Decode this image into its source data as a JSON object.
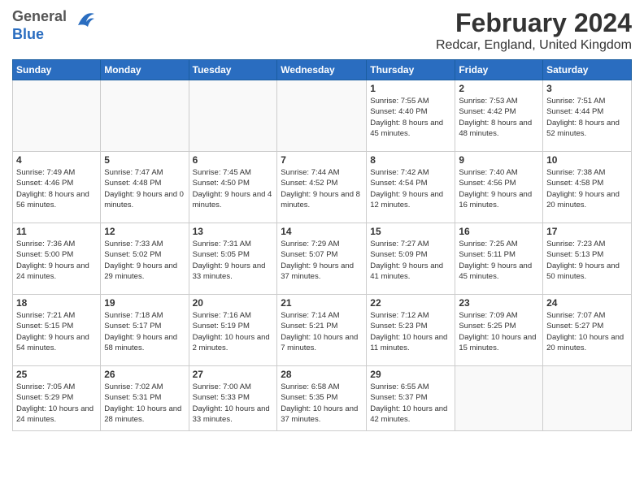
{
  "header": {
    "logo_general": "General",
    "logo_blue": "Blue",
    "title": "February 2024",
    "subtitle": "Redcar, England, United Kingdom"
  },
  "days_of_week": [
    "Sunday",
    "Monday",
    "Tuesday",
    "Wednesday",
    "Thursday",
    "Friday",
    "Saturday"
  ],
  "weeks": [
    [
      {
        "day": "",
        "sunrise": "",
        "sunset": "",
        "daylight": ""
      },
      {
        "day": "",
        "sunrise": "",
        "sunset": "",
        "daylight": ""
      },
      {
        "day": "",
        "sunrise": "",
        "sunset": "",
        "daylight": ""
      },
      {
        "day": "",
        "sunrise": "",
        "sunset": "",
        "daylight": ""
      },
      {
        "day": "1",
        "sunrise": "Sunrise: 7:55 AM",
        "sunset": "Sunset: 4:40 PM",
        "daylight": "Daylight: 8 hours and 45 minutes."
      },
      {
        "day": "2",
        "sunrise": "Sunrise: 7:53 AM",
        "sunset": "Sunset: 4:42 PM",
        "daylight": "Daylight: 8 hours and 48 minutes."
      },
      {
        "day": "3",
        "sunrise": "Sunrise: 7:51 AM",
        "sunset": "Sunset: 4:44 PM",
        "daylight": "Daylight: 8 hours and 52 minutes."
      }
    ],
    [
      {
        "day": "4",
        "sunrise": "Sunrise: 7:49 AM",
        "sunset": "Sunset: 4:46 PM",
        "daylight": "Daylight: 8 hours and 56 minutes."
      },
      {
        "day": "5",
        "sunrise": "Sunrise: 7:47 AM",
        "sunset": "Sunset: 4:48 PM",
        "daylight": "Daylight: 9 hours and 0 minutes."
      },
      {
        "day": "6",
        "sunrise": "Sunrise: 7:45 AM",
        "sunset": "Sunset: 4:50 PM",
        "daylight": "Daylight: 9 hours and 4 minutes."
      },
      {
        "day": "7",
        "sunrise": "Sunrise: 7:44 AM",
        "sunset": "Sunset: 4:52 PM",
        "daylight": "Daylight: 9 hours and 8 minutes."
      },
      {
        "day": "8",
        "sunrise": "Sunrise: 7:42 AM",
        "sunset": "Sunset: 4:54 PM",
        "daylight": "Daylight: 9 hours and 12 minutes."
      },
      {
        "day": "9",
        "sunrise": "Sunrise: 7:40 AM",
        "sunset": "Sunset: 4:56 PM",
        "daylight": "Daylight: 9 hours and 16 minutes."
      },
      {
        "day": "10",
        "sunrise": "Sunrise: 7:38 AM",
        "sunset": "Sunset: 4:58 PM",
        "daylight": "Daylight: 9 hours and 20 minutes."
      }
    ],
    [
      {
        "day": "11",
        "sunrise": "Sunrise: 7:36 AM",
        "sunset": "Sunset: 5:00 PM",
        "daylight": "Daylight: 9 hours and 24 minutes."
      },
      {
        "day": "12",
        "sunrise": "Sunrise: 7:33 AM",
        "sunset": "Sunset: 5:02 PM",
        "daylight": "Daylight: 9 hours and 29 minutes."
      },
      {
        "day": "13",
        "sunrise": "Sunrise: 7:31 AM",
        "sunset": "Sunset: 5:05 PM",
        "daylight": "Daylight: 9 hours and 33 minutes."
      },
      {
        "day": "14",
        "sunrise": "Sunrise: 7:29 AM",
        "sunset": "Sunset: 5:07 PM",
        "daylight": "Daylight: 9 hours and 37 minutes."
      },
      {
        "day": "15",
        "sunrise": "Sunrise: 7:27 AM",
        "sunset": "Sunset: 5:09 PM",
        "daylight": "Daylight: 9 hours and 41 minutes."
      },
      {
        "day": "16",
        "sunrise": "Sunrise: 7:25 AM",
        "sunset": "Sunset: 5:11 PM",
        "daylight": "Daylight: 9 hours and 45 minutes."
      },
      {
        "day": "17",
        "sunrise": "Sunrise: 7:23 AM",
        "sunset": "Sunset: 5:13 PM",
        "daylight": "Daylight: 9 hours and 50 minutes."
      }
    ],
    [
      {
        "day": "18",
        "sunrise": "Sunrise: 7:21 AM",
        "sunset": "Sunset: 5:15 PM",
        "daylight": "Daylight: 9 hours and 54 minutes."
      },
      {
        "day": "19",
        "sunrise": "Sunrise: 7:18 AM",
        "sunset": "Sunset: 5:17 PM",
        "daylight": "Daylight: 9 hours and 58 minutes."
      },
      {
        "day": "20",
        "sunrise": "Sunrise: 7:16 AM",
        "sunset": "Sunset: 5:19 PM",
        "daylight": "Daylight: 10 hours and 2 minutes."
      },
      {
        "day": "21",
        "sunrise": "Sunrise: 7:14 AM",
        "sunset": "Sunset: 5:21 PM",
        "daylight": "Daylight: 10 hours and 7 minutes."
      },
      {
        "day": "22",
        "sunrise": "Sunrise: 7:12 AM",
        "sunset": "Sunset: 5:23 PM",
        "daylight": "Daylight: 10 hours and 11 minutes."
      },
      {
        "day": "23",
        "sunrise": "Sunrise: 7:09 AM",
        "sunset": "Sunset: 5:25 PM",
        "daylight": "Daylight: 10 hours and 15 minutes."
      },
      {
        "day": "24",
        "sunrise": "Sunrise: 7:07 AM",
        "sunset": "Sunset: 5:27 PM",
        "daylight": "Daylight: 10 hours and 20 minutes."
      }
    ],
    [
      {
        "day": "25",
        "sunrise": "Sunrise: 7:05 AM",
        "sunset": "Sunset: 5:29 PM",
        "daylight": "Daylight: 10 hours and 24 minutes."
      },
      {
        "day": "26",
        "sunrise": "Sunrise: 7:02 AM",
        "sunset": "Sunset: 5:31 PM",
        "daylight": "Daylight: 10 hours and 28 minutes."
      },
      {
        "day": "27",
        "sunrise": "Sunrise: 7:00 AM",
        "sunset": "Sunset: 5:33 PM",
        "daylight": "Daylight: 10 hours and 33 minutes."
      },
      {
        "day": "28",
        "sunrise": "Sunrise: 6:58 AM",
        "sunset": "Sunset: 5:35 PM",
        "daylight": "Daylight: 10 hours and 37 minutes."
      },
      {
        "day": "29",
        "sunrise": "Sunrise: 6:55 AM",
        "sunset": "Sunset: 5:37 PM",
        "daylight": "Daylight: 10 hours and 42 minutes."
      },
      {
        "day": "",
        "sunrise": "",
        "sunset": "",
        "daylight": ""
      },
      {
        "day": "",
        "sunrise": "",
        "sunset": "",
        "daylight": ""
      }
    ]
  ]
}
